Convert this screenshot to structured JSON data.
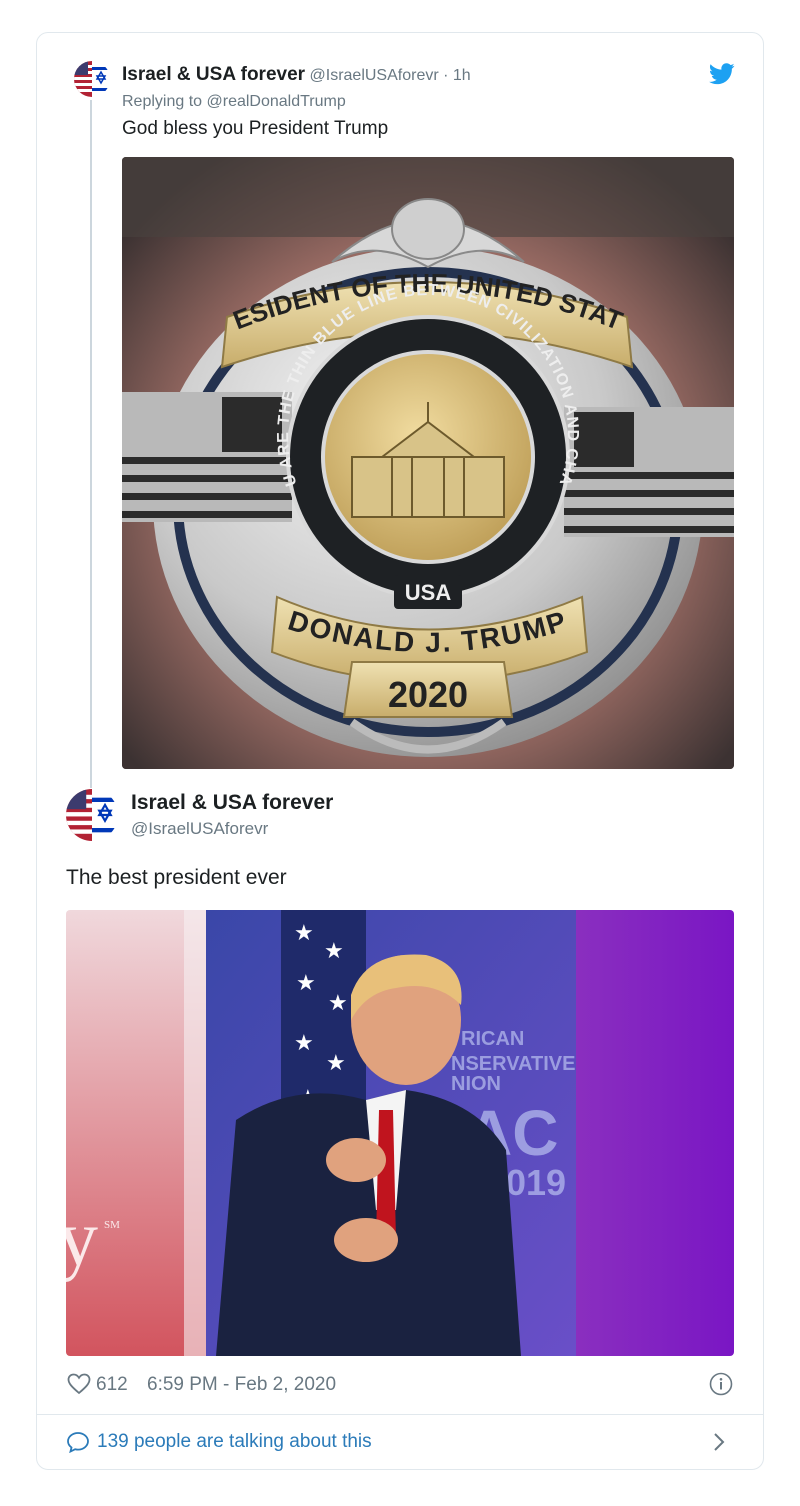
{
  "parent_tweet": {
    "display_name": "Israel & USA forever",
    "handle": "@IsraelUSAforevr",
    "separator": " · ",
    "time_ago": "1h",
    "replying_prefix": "Replying to ",
    "replying_to": "@realDonaldTrump",
    "text": "God bless you President Trump",
    "image": {
      "banner_top": "PRESIDENT OF THE UNITED STATES",
      "ring_text": "YOU ARE THE THIN BLUE LINE BETWEEN CIVILIZATION AND CHAOS",
      "center_text": "USA",
      "name_banner": "DONALD J. TRUMP",
      "year_banner": "2020"
    }
  },
  "main_tweet": {
    "display_name": "Israel & USA forever",
    "handle": "@IsraelUSAforevr",
    "text": "The best president ever",
    "image": {
      "backdrop_lines": [
        "RICAN",
        "NSERVATIVE",
        "NION"
      ],
      "backdrop_big": "AC",
      "backdrop_year": "019",
      "left_letter": "y",
      "left_sm": "SM"
    },
    "likes": "612",
    "timestamp": "6:59 PM - Feb 2, 2020",
    "talking": "139 people are talking about this"
  },
  "colors": {
    "twitter_blue": "#1da1f2",
    "link_blue": "#2b7bb9",
    "muted": "#697882",
    "border": "#e1e8ed"
  },
  "icons": [
    "twitter-bird-icon",
    "heart-icon",
    "info-icon",
    "chat-bubble-icon",
    "chevron-right-icon"
  ]
}
